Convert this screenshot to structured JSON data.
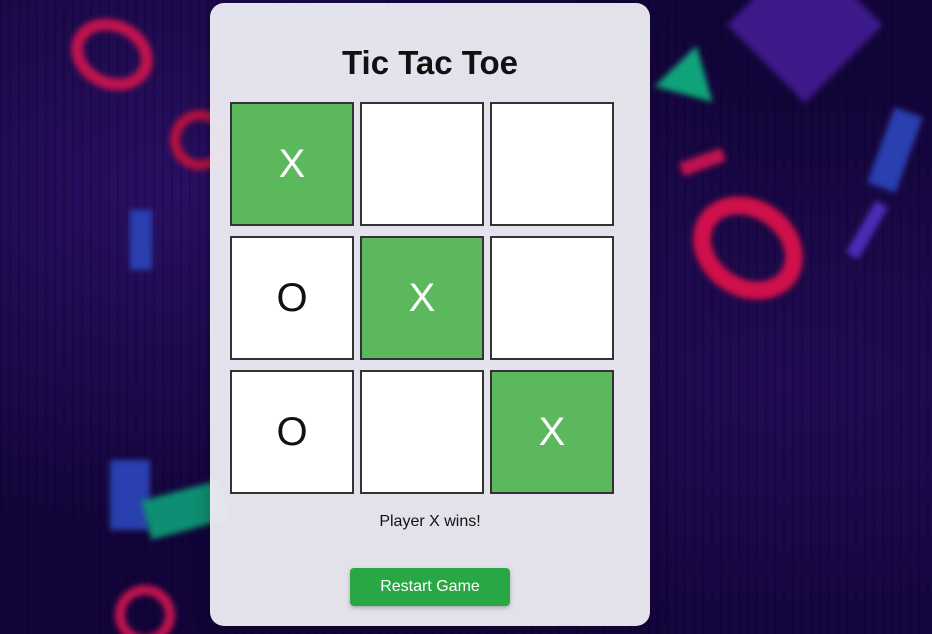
{
  "game": {
    "title": "Tic Tac Toe",
    "status": "Player X wins!",
    "restart_label": "Restart Game",
    "board": [
      {
        "mark": "X",
        "winning": true
      },
      {
        "mark": "",
        "winning": false
      },
      {
        "mark": "",
        "winning": false
      },
      {
        "mark": "O",
        "winning": false
      },
      {
        "mark": "X",
        "winning": true
      },
      {
        "mark": "",
        "winning": false
      },
      {
        "mark": "O",
        "winning": false
      },
      {
        "mark": "",
        "winning": false
      },
      {
        "mark": "X",
        "winning": true
      }
    ]
  },
  "colors": {
    "winning_cell": "#5cb85c",
    "restart_button": "#28a745",
    "card_background": "#ecebf2"
  }
}
